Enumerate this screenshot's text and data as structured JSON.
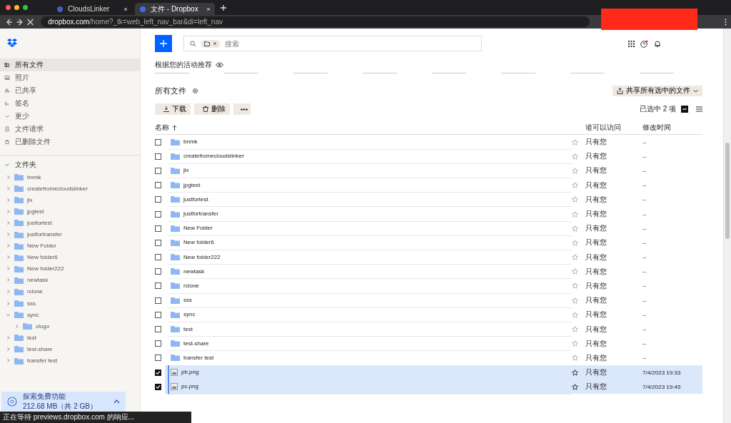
{
  "browser": {
    "tabs": [
      {
        "title": "CloudsLinker",
        "selected": false
      },
      {
        "title": "文件 - Dropbox",
        "selected": true
      }
    ],
    "url": {
      "host": "dropbox.com",
      "path": "/home?_tk=web_left_nav_bar&di=left_nav"
    }
  },
  "sidebar": {
    "nav": [
      {
        "label": "所有文件",
        "kind": "files",
        "selected": true
      },
      {
        "label": "照片",
        "kind": "photos",
        "selected": false
      },
      {
        "label": "已共享",
        "kind": "shared",
        "selected": false
      },
      {
        "label": "签名",
        "kind": "signature",
        "selected": false
      },
      {
        "label": "更少",
        "kind": "less",
        "selected": false
      },
      {
        "label": "文件请求",
        "kind": "requests",
        "selected": false
      },
      {
        "label": "已删除文件",
        "kind": "deleted",
        "selected": false
      }
    ],
    "folders_header": "文件夹",
    "folders": [
      {
        "name": "bnmk",
        "expanded": false
      },
      {
        "name": "createfromecloudslinker",
        "expanded": false
      },
      {
        "name": "jlx",
        "expanded": false
      },
      {
        "name": "jpgtest",
        "expanded": false
      },
      {
        "name": "justfortest",
        "expanded": false
      },
      {
        "name": "justfortransfer",
        "expanded": false
      },
      {
        "name": "New Folder",
        "expanded": false
      },
      {
        "name": "New folder6",
        "expanded": false
      },
      {
        "name": "New folder222",
        "expanded": false
      },
      {
        "name": "newtask",
        "expanded": false
      },
      {
        "name": "rclone",
        "expanded": false
      },
      {
        "name": "sss",
        "expanded": false
      },
      {
        "name": "sync",
        "expanded": true,
        "children": [
          {
            "name": "clogo",
            "expanded": false
          }
        ]
      },
      {
        "name": "test",
        "expanded": false
      },
      {
        "name": "test-share",
        "expanded": false
      },
      {
        "name": "transfer test",
        "expanded": false
      }
    ],
    "upsell": {
      "title": "探索免费功能",
      "detail": "212.68 MB（共 2 GB）"
    }
  },
  "search": {
    "placeholder": "搜索"
  },
  "recommend_label": "根据您的活动推荐",
  "title": "所有文件",
  "share_button": "共享所有选中的文件",
  "actions": [
    "下载",
    "删除"
  ],
  "selection_count": "已选中 2 项",
  "columns": [
    "名称",
    "谁可以访问",
    "修改时间"
  ],
  "rows": [
    {
      "name": "bnmk",
      "kind": "folder",
      "access": "只有您",
      "modified": "--",
      "checked": false
    },
    {
      "name": "createfromecloudslinker",
      "kind": "folder",
      "access": "只有您",
      "modified": "--",
      "checked": false
    },
    {
      "name": "jlx",
      "kind": "folder",
      "access": "只有您",
      "modified": "--",
      "checked": false
    },
    {
      "name": "jpgtest",
      "kind": "folder",
      "access": "只有您",
      "modified": "--",
      "checked": false
    },
    {
      "name": "justfortest",
      "kind": "folder",
      "access": "只有您",
      "modified": "--",
      "checked": false
    },
    {
      "name": "justfortransfer",
      "kind": "folder",
      "access": "只有您",
      "modified": "--",
      "checked": false
    },
    {
      "name": "New Folder",
      "kind": "folder",
      "access": "只有您",
      "modified": "--",
      "checked": false
    },
    {
      "name": "New folder6",
      "kind": "folder",
      "access": "只有您",
      "modified": "--",
      "checked": false
    },
    {
      "name": "New folder222",
      "kind": "folder",
      "access": "只有您",
      "modified": "--",
      "checked": false
    },
    {
      "name": "newtask",
      "kind": "folder",
      "access": "只有您",
      "modified": "--",
      "checked": false
    },
    {
      "name": "rclone",
      "kind": "folder",
      "access": "只有您",
      "modified": "--",
      "checked": false
    },
    {
      "name": "sss",
      "kind": "folder",
      "access": "只有您",
      "modified": "--",
      "checked": false
    },
    {
      "name": "sync",
      "kind": "folder",
      "access": "只有您",
      "modified": "--",
      "checked": false
    },
    {
      "name": "test",
      "kind": "folder",
      "access": "只有您",
      "modified": "--",
      "checked": false
    },
    {
      "name": "test-share",
      "kind": "folder",
      "access": "只有您",
      "modified": "--",
      "checked": false
    },
    {
      "name": "transfer test",
      "kind": "folder",
      "access": "只有您",
      "modified": "--",
      "checked": false
    },
    {
      "name": "pb.png",
      "kind": "image",
      "access": "只有您",
      "modified": "7/4/2023 19:33",
      "checked": true
    },
    {
      "name": "pc.png",
      "kind": "image",
      "access": "只有您",
      "modified": "7/4/2023 19:45",
      "checked": true
    }
  ],
  "status_text": "正在等待 previews.dropbox.com 的响应..."
}
